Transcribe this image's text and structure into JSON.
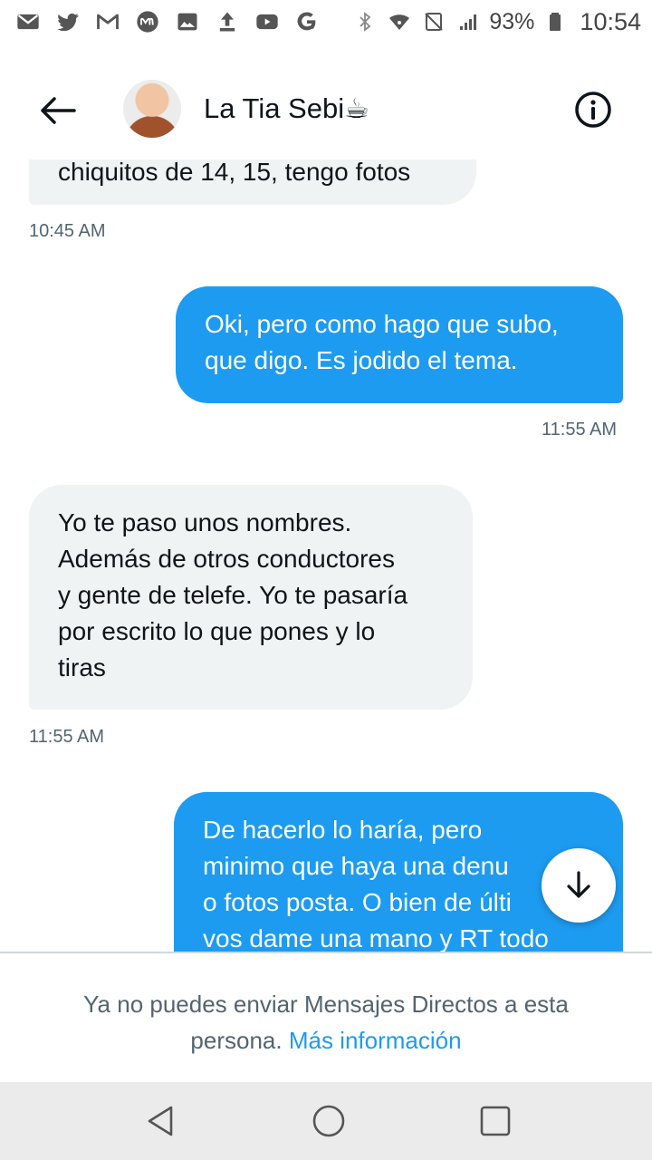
{
  "status_bar": {
    "icons_left": [
      "gmail-icon",
      "twitter-icon",
      "gmail-icon",
      "mercadopago-icon",
      "gallery-icon",
      "upload-icon",
      "youtube-icon",
      "google-icon"
    ],
    "icons_right": [
      "bluetooth-icon",
      "wifi-icon",
      "nfc-icon",
      "signal-icon"
    ],
    "battery": "93%",
    "time": "10:54"
  },
  "header": {
    "name": "La Tia Sebi☕",
    "icons": [
      "back-arrow-icon",
      "info-icon"
    ]
  },
  "messages": [
    {
      "direction": "incoming",
      "lines": [
        "chiquitos de 14, 15, tengo fotos"
      ],
      "time": "10:45 AM"
    },
    {
      "direction": "outgoing",
      "lines": [
        "Oki, pero como hago que subo,",
        "que digo. Es jodido el tema."
      ],
      "time": "11:55 AM"
    },
    {
      "direction": "incoming",
      "lines": [
        "Yo te paso unos nombres.",
        "Además de otros conductores",
        "y gente de telefe. Yo te pasaría",
        "por escrito lo que pones y lo",
        "tiras"
      ],
      "time": "11:55 AM"
    },
    {
      "direction": "outgoing",
      "lines": [
        "De hacerlo lo haría, pero",
        "minimo que haya una denu",
        "o fotos posta. O bien de últi",
        "vos dame una mano y RT todo"
      ]
    }
  ],
  "footer": {
    "notice_text": "Ya no puedes enviar Mensajes Directos a esta persona.",
    "link_text": "Más información"
  },
  "colors": {
    "accent": "#1d9bf0",
    "incoming_bubble": "#eff3f4",
    "secondary_text": "#536471"
  },
  "nav": {
    "icons": [
      "back-triangle-icon",
      "home-circle-icon",
      "recents-square-icon"
    ]
  }
}
